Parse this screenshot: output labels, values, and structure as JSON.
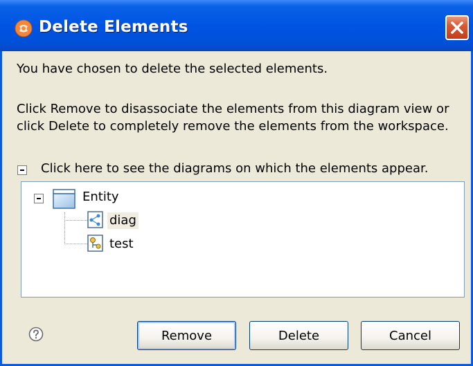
{
  "dialog": {
    "title": "Delete Elements",
    "title_icon": "app-icon",
    "close_icon": "close-icon"
  },
  "message": {
    "line1": "You have chosen to delete the selected elements.",
    "line2": "Click Remove to disassociate the elements from this diagram view or",
    "line3": "click Delete to completely remove the elements from the workspace.",
    "diagrams_toggle": "Click here to see the diagrams on which the elements appear."
  },
  "tree": {
    "root": {
      "label": "Entity",
      "icon": "entity-icon"
    },
    "children": [
      {
        "label": "diag",
        "icon": "diagram-icon"
      },
      {
        "label": "test",
        "icon": "diagram-icon"
      }
    ]
  },
  "buttons": {
    "remove": "Remove",
    "delete": "Delete",
    "cancel": "Cancel"
  },
  "help_icon": "help-icon",
  "colors": {
    "titlebar": "#0054e3",
    "dialog_bg": "#ece9d8",
    "close_button": "#d95a34"
  }
}
